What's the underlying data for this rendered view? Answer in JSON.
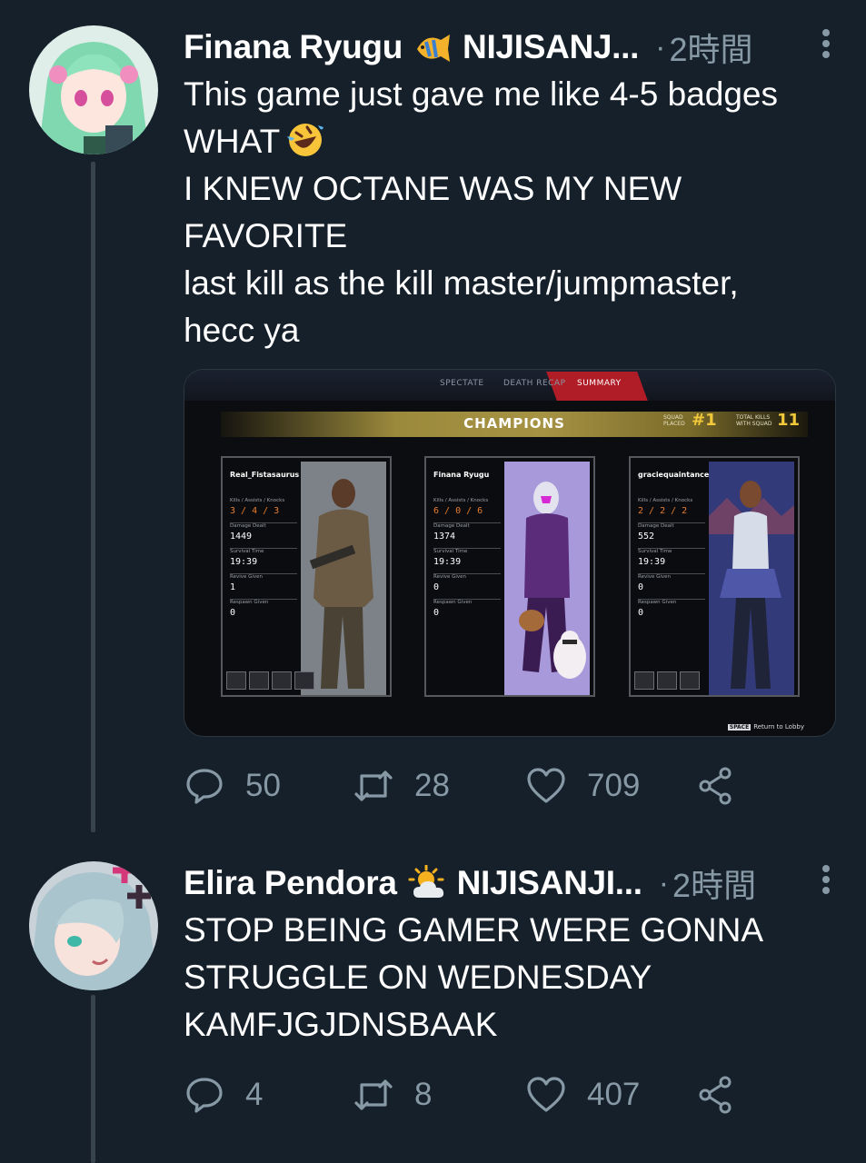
{
  "tweets": [
    {
      "name": "Finana Ryugu",
      "name_emoji": "tropical-fish-emoji",
      "handle": "NIJISANJ...",
      "time": "2時間",
      "lines": [
        "This game just gave me like 4-5 badges",
        "WHAT",
        "I KNEW OCTANE WAS MY NEW",
        "FAVORITE",
        "last kill as the kill master/jumpmaster,",
        "hecc ya"
      ],
      "inline_emoji": "rolling-on-floor-laughing-emoji",
      "reply_count": "50",
      "retweet_count": "28",
      "like_count": "709"
    },
    {
      "name": "Elira Pendora",
      "name_emoji": "sun-behind-cloud-emoji",
      "handle": "NIJISANJI...",
      "time": "2時間",
      "lines": [
        "STOP BEING GAMER WERE GONNA",
        "STRUGGLE ON WEDNESDAY",
        "KAMFJGJDNSBAAK"
      ],
      "reply_count": "4",
      "retweet_count": "8",
      "like_count": "407"
    }
  ],
  "game": {
    "tabs": [
      "SPECTATE",
      "DEATH RECAP",
      "SUMMARY"
    ],
    "banner_title": "CHAMPIONS",
    "squad_label_1": "SQUAD",
    "squad_label_2": "PLACED",
    "squad_place": "#1",
    "kills_label_1": "TOTAL KILLS",
    "kills_label_2": "WITH SQUAD",
    "total_kills": "11",
    "stat_labels": [
      "Kills / Assists / Knocks",
      "Damage Dealt",
      "Survival Time",
      "Revive Given",
      "Respawn Given"
    ],
    "players": [
      {
        "name": "Real_Fistasaurus",
        "kak": "3 / 4 / 3",
        "damage": "1449",
        "survival": "19:39",
        "revive": "1",
        "respawn": "0"
      },
      {
        "name": "Finana Ryugu",
        "kak": "6 / 0 / 6",
        "damage": "1374",
        "survival": "19:39",
        "revive": "0",
        "respawn": "0"
      },
      {
        "name": "graciequaintance",
        "kak": "2 / 2 / 2",
        "damage": "552",
        "survival": "19:39",
        "revive": "0",
        "respawn": "0"
      }
    ],
    "lobby_key": "SPACE",
    "lobby_text": "Return to Lobby"
  }
}
